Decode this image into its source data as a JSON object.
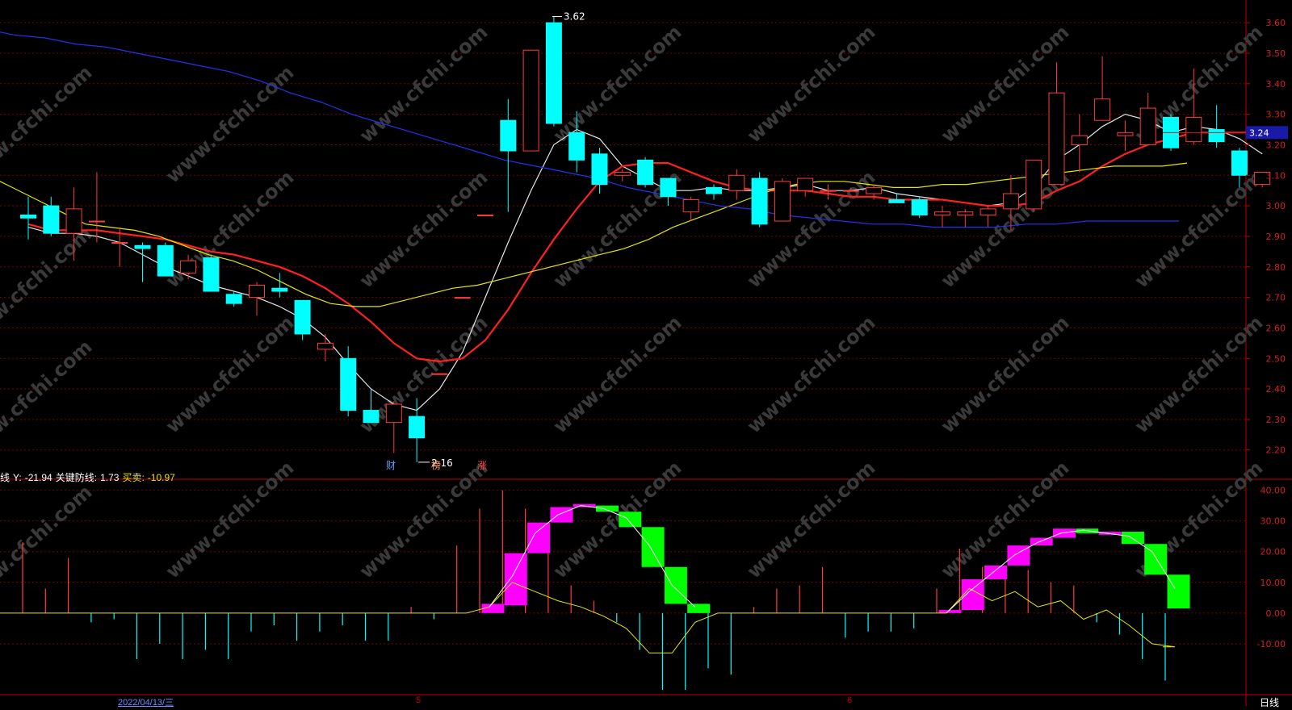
{
  "app": {
    "period_label": "日线"
  },
  "indicator_header": {
    "prefix": "线",
    "y_label": "Y:",
    "y_value": "-21.94",
    "key_label": "关键防线:",
    "key_value": "1.73",
    "trade_label": "买卖:",
    "trade_value": "-10.97"
  },
  "x_axis": {
    "date_label": "2022/04/13/三",
    "month_5": "5",
    "month_6": "6"
  },
  "markers": {
    "cai": "财",
    "bang": "榜",
    "zhang": "涨"
  },
  "watermark": "www.cfchi.com",
  "colors": {
    "up": "#ff3b3b",
    "down": "#00ffff",
    "ma5": "#e6e6e6",
    "ma10": "#ff2020",
    "ma20": "#e6e600",
    "ma60": "#2233ee",
    "grid": "#7a0000",
    "magenta": "#ff00ff",
    "green": "#00ff00"
  },
  "chart_data": [
    {
      "type": "candlestick",
      "title": "",
      "ylim": [
        2.12,
        3.64
      ],
      "ytick_labels": [
        "2.20",
        "2.30",
        "2.40",
        "2.50",
        "2.60",
        "2.70",
        "2.80",
        "2.90",
        "3.00",
        "3.10",
        "3.20",
        "3.30",
        "3.40",
        "3.50",
        "3.60"
      ],
      "current_price_label": "3.24",
      "current_price": 3.24,
      "high_annotation": "3.62",
      "low_annotation": "2.16",
      "candles": [
        {
          "o": 2.97,
          "h": 3.03,
          "l": 2.89,
          "c": 2.96
        },
        {
          "o": 3.0,
          "h": 3.03,
          "l": 2.9,
          "c": 2.91
        },
        {
          "o": 2.91,
          "h": 3.06,
          "l": 2.82,
          "c": 2.99
        },
        {
          "o": 2.95,
          "h": 3.11,
          "l": 2.88,
          "c": 2.95
        },
        {
          "o": 2.88,
          "h": 2.93,
          "l": 2.8,
          "c": 2.88
        },
        {
          "o": 2.87,
          "h": 2.88,
          "l": 2.75,
          "c": 2.86
        },
        {
          "o": 2.87,
          "h": 2.88,
          "l": 2.77,
          "c": 2.77
        },
        {
          "o": 2.78,
          "h": 2.84,
          "l": 2.76,
          "c": 2.82
        },
        {
          "o": 2.83,
          "h": 2.84,
          "l": 2.72,
          "c": 2.72
        },
        {
          "o": 2.71,
          "h": 2.72,
          "l": 2.67,
          "c": 2.68
        },
        {
          "o": 2.7,
          "h": 2.75,
          "l": 2.64,
          "c": 2.74
        },
        {
          "o": 2.73,
          "h": 2.78,
          "l": 2.7,
          "c": 2.72
        },
        {
          "o": 2.69,
          "h": 2.69,
          "l": 2.56,
          "c": 2.58
        },
        {
          "o": 2.53,
          "h": 2.58,
          "l": 2.49,
          "c": 2.55
        },
        {
          "o": 2.5,
          "h": 2.54,
          "l": 2.31,
          "c": 2.33
        },
        {
          "o": 2.33,
          "h": 2.4,
          "l": 2.29,
          "c": 2.29
        },
        {
          "o": 2.29,
          "h": 2.36,
          "l": 2.19,
          "c": 2.35
        },
        {
          "o": 2.31,
          "h": 2.37,
          "l": 2.16,
          "c": 2.24
        },
        {
          "o": 2.45,
          "h": 2.45,
          "l": 2.45,
          "c": 2.45
        },
        {
          "o": 2.7,
          "h": 2.7,
          "l": 2.7,
          "c": 2.7
        },
        {
          "o": 2.97,
          "h": 2.97,
          "l": 2.97,
          "c": 2.97
        },
        {
          "o": 3.28,
          "h": 3.35,
          "l": 2.98,
          "c": 3.18
        },
        {
          "o": 3.18,
          "h": 3.51,
          "l": 3.18,
          "c": 3.51
        },
        {
          "o": 3.6,
          "h": 3.62,
          "l": 3.26,
          "c": 3.27
        },
        {
          "o": 3.24,
          "h": 3.31,
          "l": 3.11,
          "c": 3.15
        },
        {
          "o": 3.17,
          "h": 3.19,
          "l": 3.04,
          "c": 3.07
        },
        {
          "o": 3.1,
          "h": 3.12,
          "l": 3.08,
          "c": 3.11
        },
        {
          "o": 3.15,
          "h": 3.16,
          "l": 3.06,
          "c": 3.07
        },
        {
          "o": 3.09,
          "h": 3.09,
          "l": 3.0,
          "c": 3.03
        },
        {
          "o": 2.98,
          "h": 3.03,
          "l": 2.95,
          "c": 3.02
        },
        {
          "o": 3.06,
          "h": 3.07,
          "l": 3.02,
          "c": 3.04
        },
        {
          "o": 3.05,
          "h": 3.12,
          "l": 3.02,
          "c": 3.1
        },
        {
          "o": 3.09,
          "h": 3.11,
          "l": 2.93,
          "c": 2.94
        },
        {
          "o": 2.95,
          "h": 3.09,
          "l": 2.95,
          "c": 3.08
        },
        {
          "o": 3.05,
          "h": 3.09,
          "l": 3.03,
          "c": 3.09
        },
        {
          "o": 3.05,
          "h": 3.07,
          "l": 3.02,
          "c": 3.05
        },
        {
          "o": 3.05,
          "h": 3.06,
          "l": 3.05,
          "c": 3.05
        },
        {
          "o": 3.04,
          "h": 3.07,
          "l": 3.02,
          "c": 3.06
        },
        {
          "o": 3.02,
          "h": 3.04,
          "l": 3.01,
          "c": 3.01
        },
        {
          "o": 3.02,
          "h": 3.03,
          "l": 2.96,
          "c": 2.97
        },
        {
          "o": 2.97,
          "h": 3.0,
          "l": 2.93,
          "c": 2.98
        },
        {
          "o": 2.97,
          "h": 2.99,
          "l": 2.93,
          "c": 2.98
        },
        {
          "o": 2.97,
          "h": 3.0,
          "l": 2.93,
          "c": 2.99
        },
        {
          "o": 2.99,
          "h": 3.1,
          "l": 2.92,
          "c": 3.04
        },
        {
          "o": 2.99,
          "h": 3.15,
          "l": 2.98,
          "c": 3.15
        },
        {
          "o": 3.07,
          "h": 3.47,
          "l": 3.07,
          "c": 3.37
        },
        {
          "o": 3.2,
          "h": 3.3,
          "l": 3.11,
          "c": 3.23
        },
        {
          "o": 3.28,
          "h": 3.49,
          "l": 3.28,
          "c": 3.35
        },
        {
          "o": 3.23,
          "h": 3.28,
          "l": 3.18,
          "c": 3.24
        },
        {
          "o": 3.2,
          "h": 3.37,
          "l": 3.2,
          "c": 3.32
        },
        {
          "o": 3.29,
          "h": 3.3,
          "l": 3.18,
          "c": 3.19
        },
        {
          "o": 3.21,
          "h": 3.45,
          "l": 3.2,
          "c": 3.29
        },
        {
          "o": 3.25,
          "h": 3.33,
          "l": 3.19,
          "c": 3.21
        },
        {
          "o": 3.18,
          "h": 3.19,
          "l": 3.06,
          "c": 3.1
        },
        {
          "o": 3.07,
          "h": 3.11,
          "l": 3.06,
          "c": 3.11
        }
      ],
      "series": [
        {
          "key": "ma5",
          "values": [
            2.93,
            2.91,
            2.91,
            2.9,
            2.88,
            2.84,
            2.8,
            2.77,
            2.74,
            2.72,
            2.7,
            2.67,
            2.63,
            2.57,
            2.48,
            2.4,
            2.35,
            2.33,
            2.4,
            2.52,
            2.7,
            2.88,
            3.05,
            3.2,
            3.25,
            3.22,
            3.13,
            3.09,
            3.05,
            3.05,
            3.06,
            3.05,
            3.05,
            3.06,
            3.07,
            3.05,
            3.05,
            3.06,
            3.04,
            3.03,
            3.02,
            3.01,
            3.0,
            3.01,
            3.06,
            3.15,
            3.2,
            3.26,
            3.3,
            3.28,
            3.24,
            3.26,
            3.25,
            3.22,
            3.17
          ]
        },
        {
          "key": "ma10",
          "values": [
            2.94,
            2.92,
            2.92,
            2.92,
            2.91,
            2.9,
            2.89,
            2.87,
            2.85,
            2.84,
            2.82,
            2.8,
            2.77,
            2.73,
            2.68,
            2.62,
            2.55,
            2.5,
            2.49,
            2.5,
            2.56,
            2.66,
            2.78,
            2.89,
            2.99,
            3.08,
            3.13,
            3.14,
            3.14,
            3.11,
            3.08,
            3.06,
            3.05,
            3.05,
            3.05,
            3.04,
            3.03,
            3.03,
            3.02,
            3.02,
            3.02,
            3.01,
            3.0,
            3.0,
            3.01,
            3.05,
            3.08,
            3.13,
            3.17,
            3.2,
            3.22,
            3.24,
            3.24,
            3.24,
            3.24
          ]
        },
        {
          "key": "ma20",
          "values": [
            3.1,
            3.06,
            3.02,
            2.98,
            2.94,
            2.93,
            2.92,
            2.9,
            2.87,
            2.84,
            2.82,
            2.79,
            2.75,
            2.71,
            2.68,
            2.67,
            2.67,
            2.69,
            2.71,
            2.73,
            2.74,
            2.76,
            2.78,
            2.8,
            2.82,
            2.84,
            2.86,
            2.89,
            2.93,
            2.96,
            2.99,
            3.02,
            3.05,
            3.07,
            3.08,
            3.08,
            3.07,
            3.06,
            3.06,
            3.07,
            3.07,
            3.08,
            3.09,
            3.1,
            3.11,
            3.12,
            3.13,
            3.13,
            3.13,
            3.14
          ]
        },
        {
          "key": "ma60",
          "values": [
            3.58,
            3.56,
            3.55,
            3.53,
            3.52,
            3.5,
            3.48,
            3.46,
            3.44,
            3.41,
            3.37,
            3.34,
            3.3,
            3.27,
            3.24,
            3.21,
            3.18,
            3.15,
            3.13,
            3.11,
            3.09,
            3.06,
            3.04,
            3.02,
            3.0,
            2.99,
            2.97,
            2.96,
            2.95,
            2.94,
            2.94,
            2.93,
            2.93,
            2.93,
            2.94,
            2.94,
            2.95,
            2.95,
            2.95,
            2.95
          ]
        }
      ]
    },
    {
      "type": "bar",
      "title": "",
      "ylim": [
        -25,
        42
      ],
      "ytick_labels": [
        "-10.00",
        "0.00",
        "10.00",
        "20.00",
        "30.00",
        "40.00"
      ],
      "bars": [
        {
          "i": 0,
          "v": 23
        },
        {
          "i": 1,
          "v": 8
        },
        {
          "i": 2,
          "v": 18
        },
        {
          "i": 3,
          "v": -3
        },
        {
          "i": 4,
          "v": -2
        },
        {
          "i": 5,
          "v": -15
        },
        {
          "i": 6,
          "v": -10
        },
        {
          "i": 7,
          "v": -15
        },
        {
          "i": 8,
          "v": -12
        },
        {
          "i": 9,
          "v": -15
        },
        {
          "i": 10,
          "v": -6
        },
        {
          "i": 11,
          "v": -4
        },
        {
          "i": 12,
          "v": -9
        },
        {
          "i": 13,
          "v": -6
        },
        {
          "i": 14,
          "v": -4
        },
        {
          "i": 15,
          "v": -9
        },
        {
          "i": 16,
          "v": -9
        },
        {
          "i": 17,
          "v": 2
        },
        {
          "i": 18,
          "v": -2
        },
        {
          "i": 19,
          "v": 22
        },
        {
          "i": 20,
          "v": 34
        },
        {
          "i": 21,
          "v": 40
        },
        {
          "i": 22,
          "v": 34
        },
        {
          "i": 23,
          "v": 28
        },
        {
          "i": 24,
          "v": 9
        },
        {
          "i": 25,
          "v": 4
        },
        {
          "i": 26,
          "v": -3
        },
        {
          "i": 27,
          "v": -12
        },
        {
          "i": 28,
          "v": -25
        },
        {
          "i": 29,
          "v": -25
        },
        {
          "i": 30,
          "v": -18
        },
        {
          "i": 31,
          "v": -20
        },
        {
          "i": 32,
          "v": 2
        },
        {
          "i": 33,
          "v": 8
        },
        {
          "i": 34,
          "v": 9
        },
        {
          "i": 35,
          "v": 15
        },
        {
          "i": 36,
          "v": -8
        },
        {
          "i": 37,
          "v": -6
        },
        {
          "i": 38,
          "v": -6
        },
        {
          "i": 39,
          "v": -5
        },
        {
          "i": 40,
          "v": 8
        },
        {
          "i": 41,
          "v": 21
        },
        {
          "i": 42,
          "v": 15
        },
        {
          "i": 43,
          "v": 12
        },
        {
          "i": 44,
          "v": 14
        },
        {
          "i": 45,
          "v": 10
        },
        {
          "i": 46,
          "v": 9
        },
        {
          "i": 47,
          "v": -3
        },
        {
          "i": 48,
          "v": -7
        },
        {
          "i": 49,
          "v": -15
        },
        {
          "i": 50,
          "v": -22
        }
      ],
      "blocks": [
        {
          "i": 20,
          "a": 0,
          "b": 3,
          "color": "magenta"
        },
        {
          "i": 21,
          "a": 2.5,
          "b": 19.5,
          "color": "magenta"
        },
        {
          "i": 22,
          "a": 19.5,
          "b": 29.5,
          "color": "magenta"
        },
        {
          "i": 23,
          "a": 29.5,
          "b": 34.5,
          "color": "magenta"
        },
        {
          "i": 24,
          "a": 34.5,
          "b": 35.5,
          "color": "magenta"
        },
        {
          "i": 25,
          "a": 35,
          "b": 33,
          "color": "green"
        },
        {
          "i": 26,
          "a": 33,
          "b": 28,
          "color": "green"
        },
        {
          "i": 27,
          "a": 28,
          "b": 15,
          "color": "green"
        },
        {
          "i": 28,
          "a": 15,
          "b": 3,
          "color": "green"
        },
        {
          "i": 29,
          "a": 3,
          "b": 0,
          "color": "green"
        },
        {
          "i": 40,
          "a": 0,
          "b": 1,
          "color": "magenta"
        },
        {
          "i": 41,
          "a": 1,
          "b": 11,
          "color": "magenta"
        },
        {
          "i": 42,
          "a": 11,
          "b": 15.5,
          "color": "magenta"
        },
        {
          "i": 43,
          "a": 15.5,
          "b": 22,
          "color": "magenta"
        },
        {
          "i": 44,
          "a": 22,
          "b": 24.5,
          "color": "magenta"
        },
        {
          "i": 45,
          "a": 24.5,
          "b": 27.5,
          "color": "magenta"
        },
        {
          "i": 46,
          "a": 27.5,
          "b": 26,
          "color": "green"
        },
        {
          "i": 47,
          "a": 26.5,
          "b": 25.5,
          "color": "magenta"
        },
        {
          "i": 48,
          "a": 26.5,
          "b": 22.5,
          "color": "green"
        },
        {
          "i": 49,
          "a": 22.5,
          "b": 12.5,
          "color": "green"
        },
        {
          "i": 50,
          "a": 12.5,
          "b": 1.5,
          "color": "green"
        }
      ],
      "white_line": [
        {
          "i": 20,
          "v": 2
        },
        {
          "i": 21,
          "v": 12
        },
        {
          "i": 22,
          "v": 26
        },
        {
          "i": 23,
          "v": 32
        },
        {
          "i": 24,
          "v": 35
        },
        {
          "i": 25,
          "v": 34
        },
        {
          "i": 26,
          "v": 31
        },
        {
          "i": 27,
          "v": 22
        },
        {
          "i": 28,
          "v": 9
        },
        {
          "i": 29,
          "v": 2
        },
        {
          "i": 40,
          "v": 0
        },
        {
          "i": 41,
          "v": 7
        },
        {
          "i": 42,
          "v": 13
        },
        {
          "i": 43,
          "v": 19
        },
        {
          "i": 44,
          "v": 23
        },
        {
          "i": 45,
          "v": 26
        },
        {
          "i": 46,
          "v": 27
        },
        {
          "i": 47,
          "v": 26
        },
        {
          "i": 48,
          "v": 25
        },
        {
          "i": 49,
          "v": 20
        },
        {
          "i": 50,
          "v": 8
        }
      ],
      "yellow_line": [
        {
          "i": 0,
          "v": 0
        },
        {
          "i": 19,
          "v": 0
        },
        {
          "i": 20,
          "v": 2
        },
        {
          "i": 21,
          "v": 10
        },
        {
          "i": 22,
          "v": 7
        },
        {
          "i": 23,
          "v": 4
        },
        {
          "i": 24,
          "v": 2
        },
        {
          "i": 25,
          "v": -1
        },
        {
          "i": 26,
          "v": -5
        },
        {
          "i": 27,
          "v": -13
        },
        {
          "i": 28,
          "v": -13
        },
        {
          "i": 29,
          "v": -3
        },
        {
          "i": 30,
          "v": 0
        },
        {
          "i": 40,
          "v": 0
        },
        {
          "i": 41,
          "v": 8
        },
        {
          "i": 42,
          "v": 4
        },
        {
          "i": 43,
          "v": 7
        },
        {
          "i": 44,
          "v": 2
        },
        {
          "i": 45,
          "v": 4
        },
        {
          "i": 46,
          "v": -2
        },
        {
          "i": 47,
          "v": 1
        },
        {
          "i": 48,
          "v": -4
        },
        {
          "i": 49,
          "v": -10
        },
        {
          "i": 50,
          "v": -11
        }
      ]
    }
  ]
}
